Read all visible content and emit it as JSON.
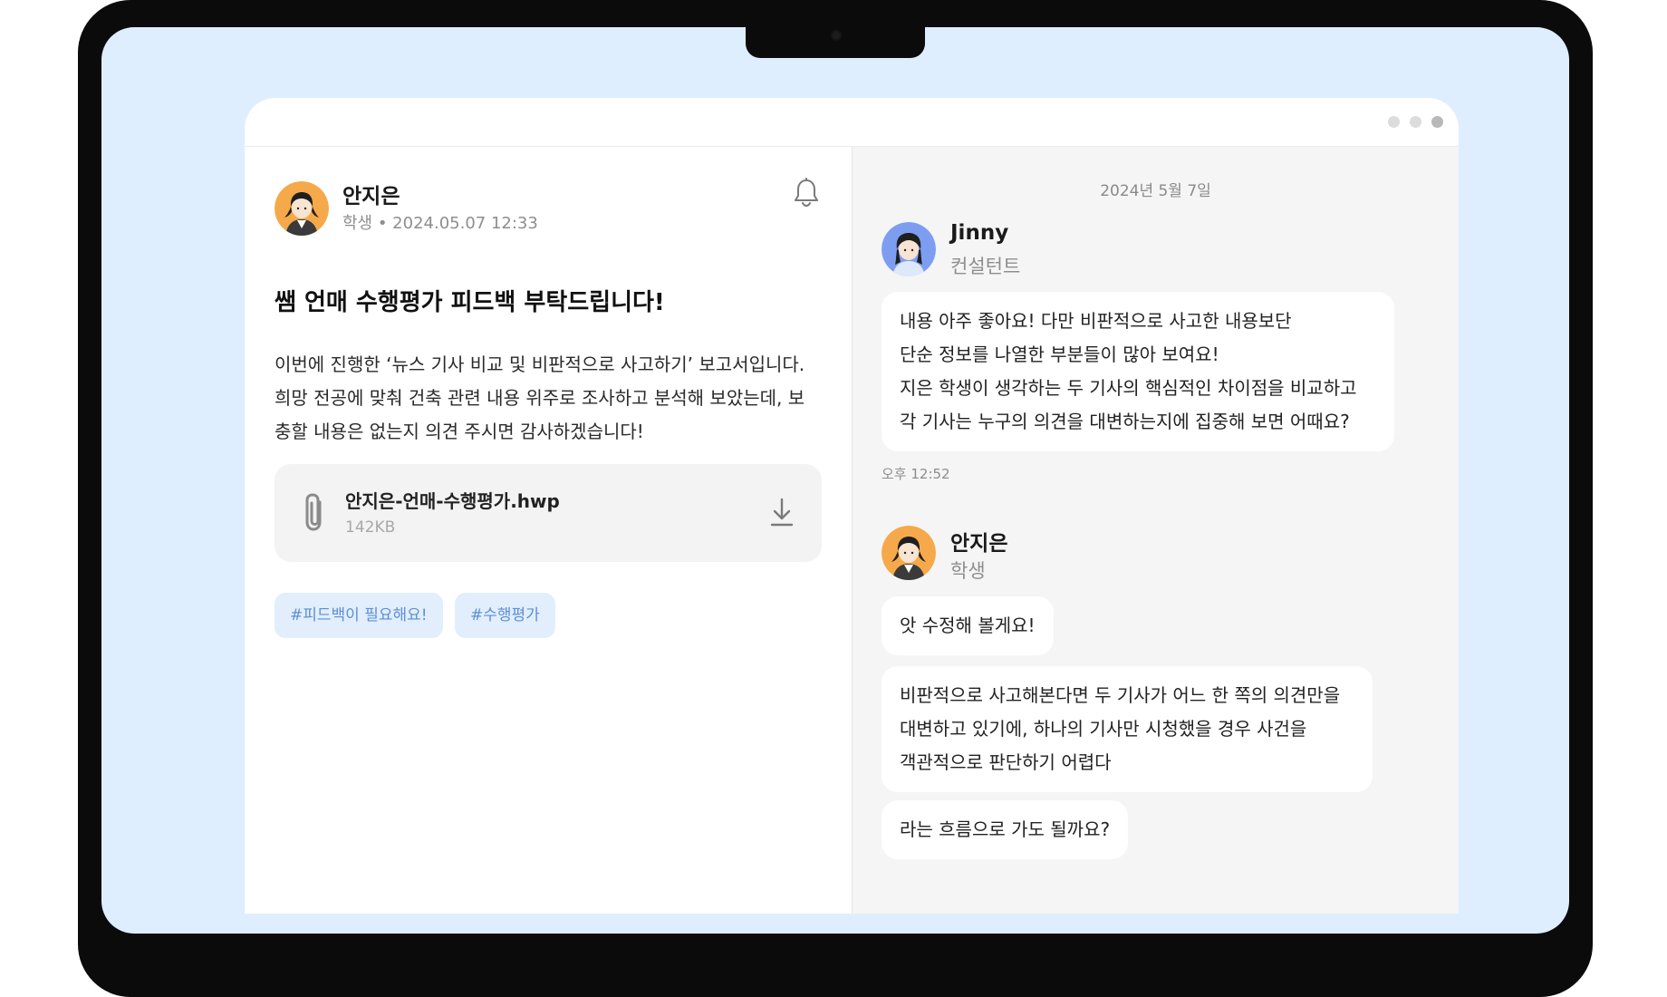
{
  "post": {
    "author": "안지은",
    "meta": "학생 • 2024.05.07 12:33",
    "title": "쌤 언매 수행평가 피드백 부탁드립니다!",
    "body": [
      "이번에 진행한 ‘뉴스 기사 비교 및 비판적으로 사고하기’ 보고서입니다.",
      "희망 전공에 맞춰 건축 관련 내용 위주로 조사하고 분석해 보았는데, 보",
      "충할 내용은 없는지 의견 주시면 감사하겠습니다!"
    ],
    "attachment": {
      "name": "안지은-언매-수행평가.hwp",
      "size": "142KB"
    },
    "tags": [
      "#피드백이 필요해요!",
      "#수행평가"
    ]
  },
  "chat": {
    "date": "2024년 5월 7일",
    "consultant": {
      "name": "Jinny",
      "role": "컨설턴트",
      "message": [
        "내용 아주 좋아요! 다만 비판적으로 사고한 내용보단",
        "단순 정보를 나열한 부분들이 많아 보여요!",
        "지은 학생이 생각하는 두 기사의 핵심적인 차이점을 비교하고",
        "각 기사는 누구의 의견을 대변하는지에 집중해 보면 어때요?"
      ],
      "time": "오후 12:52"
    },
    "student": {
      "name": "안지은",
      "role": "학생",
      "messages": [
        [
          "앗 수정해 볼게요!"
        ],
        [
          "비판적으로 사고해본다면 두 기사가 어느 한 쪽의 의견만을",
          "대변하고 있기에, 하나의 기사만 시청했을 경우 사건을",
          "객관적으로 판단하기 어렵다"
        ],
        [
          "라는 흐름으로 가도 될까요?"
        ]
      ]
    }
  },
  "icons": {
    "bell": "bell-icon",
    "attachment": "paperclip-icon",
    "download": "download-icon"
  },
  "colors": {
    "background": "#dfeefe",
    "tag_bg": "#e2eefc",
    "tag_text": "#5b8fd8",
    "student_avatar": "#f6a94a",
    "consultant_avatar": "#7d9ef0"
  }
}
